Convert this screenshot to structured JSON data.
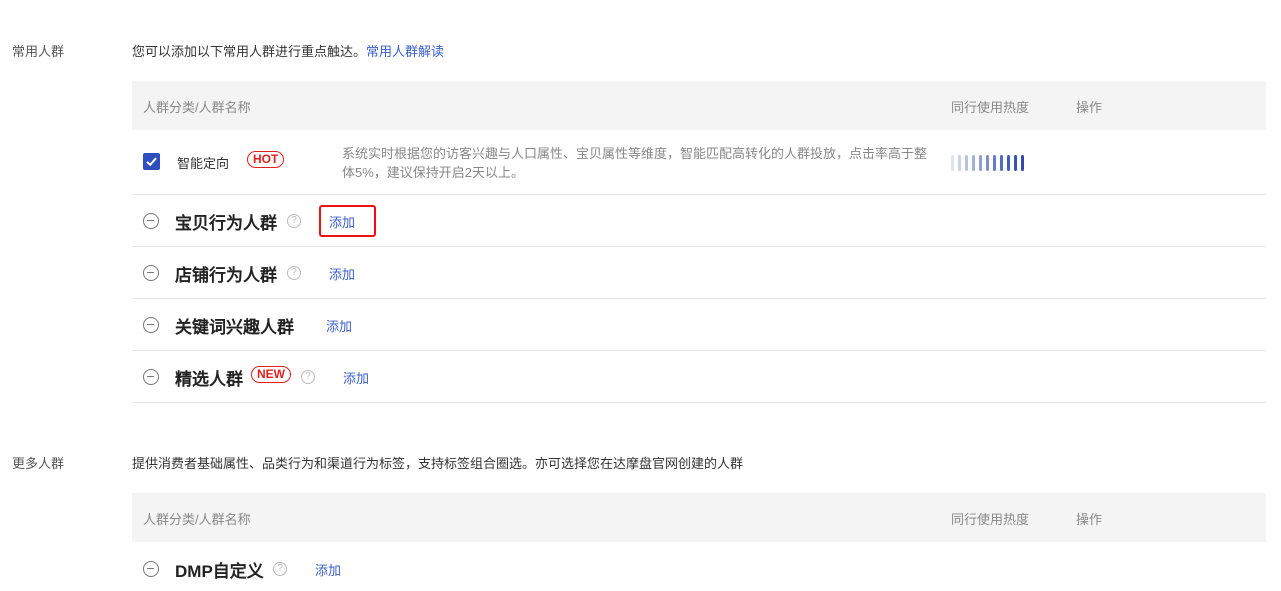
{
  "common": {
    "label": "常用人群",
    "desc": "您可以添加以下常用人群进行重点触达。",
    "desc_link": "常用人群解读",
    "header": {
      "name": "人群分类/人群名称",
      "heat": "同行使用热度",
      "op": "操作"
    },
    "smart": {
      "name": "智能定向",
      "tag": "HOT",
      "desc": "系统实时根据您的访客兴趣与人口属性、宝贝属性等维度，智能匹配高转化的人群投放，点击率高于整体5%，建议保持开启2天以上。",
      "checked": true,
      "heat_level": 0.55
    },
    "groups": [
      {
        "name": "宝贝行为人群",
        "add": "添加"
      },
      {
        "name": "店铺行为人群",
        "add": "添加"
      },
      {
        "name": "关键词兴趣人群",
        "add": "添加"
      },
      {
        "name": "精选人群",
        "tag": "NEW",
        "add": "添加"
      }
    ]
  },
  "more": {
    "label": "更多人群",
    "desc": "提供消费者基础属性、品类行为和渠道行为标签，支持标签组合圈选。亦可选择您在达摩盘官网创建的人群",
    "header": {
      "name": "人群分类/人群名称",
      "heat": "同行使用热度",
      "op": "操作"
    },
    "groups": [
      {
        "name": "DMP自定义",
        "add": "添加"
      }
    ]
  },
  "icons": {
    "help": "?"
  },
  "colors": {
    "accent": "#3a5fcd",
    "hot": "#e02020",
    "checkbox": "#2f4fbf",
    "highlight": "#ee1111"
  }
}
